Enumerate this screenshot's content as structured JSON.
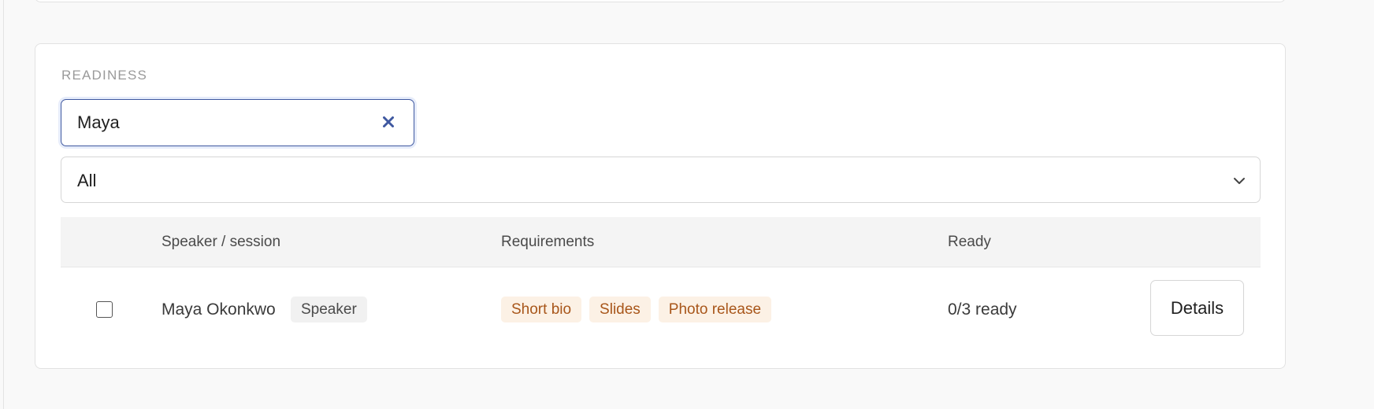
{
  "section": {
    "label": "READINESS"
  },
  "search": {
    "value": "Maya",
    "clear_icon": "close-icon"
  },
  "filter": {
    "selected": "All",
    "icon": "chevron-down-icon"
  },
  "table": {
    "columns": {
      "speaker": "Speaker / session",
      "requirements": "Requirements",
      "ready": "Ready"
    },
    "rows": [
      {
        "name": "Maya Okonkwo",
        "role": "Speaker",
        "requirements": [
          "Short bio",
          "Slides",
          "Photo release"
        ],
        "ready": "0/3 ready",
        "action": "Details",
        "checked": false
      }
    ]
  },
  "colors": {
    "focus_border": "#3f58a0",
    "chip_text": "#a8561a",
    "chip_bg": "#fcf1e5"
  }
}
